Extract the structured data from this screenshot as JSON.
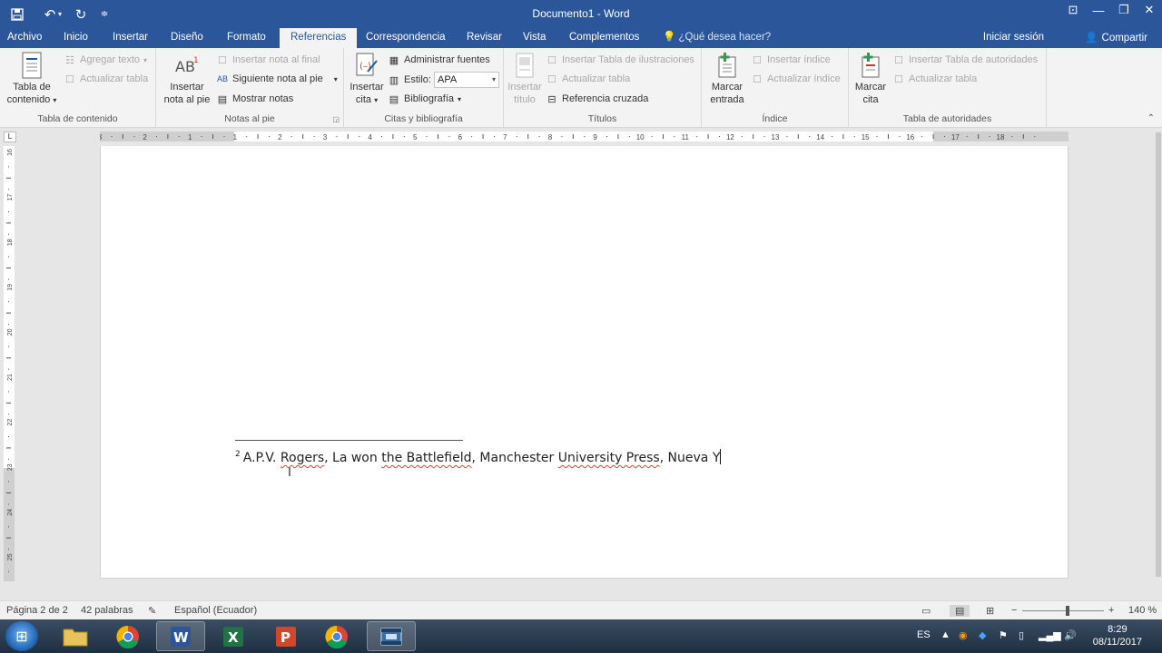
{
  "window": {
    "title": "Documento1 - Word"
  },
  "tabs": [
    {
      "label": "Archivo"
    },
    {
      "label": "Inicio"
    },
    {
      "label": "Insertar"
    },
    {
      "label": "Diseño"
    },
    {
      "label": "Formato"
    },
    {
      "label": "Referencias"
    },
    {
      "label": "Correspondencia"
    },
    {
      "label": "Revisar"
    },
    {
      "label": "Vista"
    },
    {
      "label": "Complementos"
    }
  ],
  "tell_me": "¿Qué desea hacer?",
  "sign_in": "Iniciar sesión",
  "share": "Compartir",
  "ribbon": {
    "toc": {
      "big_line1": "Tabla de",
      "big_line2": "contenido",
      "add_text": "Agregar texto",
      "update_table": "Actualizar tabla",
      "label": "Tabla de contenido"
    },
    "footnotes": {
      "big_line1": "Insertar",
      "big_line2": "nota al pie",
      "insert_endnote": "Insertar nota al final",
      "next_footnote": "Siguiente nota al pie",
      "show_notes": "Mostrar notas",
      "label": "Notas al pie"
    },
    "citations": {
      "big_line1": "Insertar",
      "big_line2": "cita",
      "manage_sources": "Administrar fuentes",
      "style_label": "Estilo:",
      "style_value": "APA",
      "bibliography": "Bibliografía",
      "label": "Citas y bibliografía"
    },
    "captions": {
      "big_line1": "Insertar",
      "big_line2": "título",
      "insert_table_figures": "Insertar Tabla de ilustraciones",
      "update_table": "Actualizar tabla",
      "cross_reference": "Referencia cruzada",
      "label": "Títulos"
    },
    "index": {
      "big_line1": "Marcar",
      "big_line2": "entrada",
      "insert_index": "Insertar índice",
      "update_index": "Actualizar índice",
      "label": "Índice"
    },
    "authorities": {
      "big_line1": "Marcar",
      "big_line2": "cita",
      "insert_table": "Insertar Tabla de autoridades",
      "update_table": "Actualizar tabla",
      "label": "Tabla de autoridades"
    }
  },
  "ruler": {
    "h_labels": [
      "3",
      "2",
      "1",
      "1",
      "2",
      "3",
      "4",
      "5",
      "6",
      "7",
      "8",
      "9",
      "10",
      "11",
      "12",
      "13",
      "14",
      "15",
      "16",
      "17",
      "18"
    ],
    "v_labels": [
      "16",
      "17",
      "18",
      "19",
      "20",
      "21",
      "22",
      "23",
      "24",
      "25"
    ]
  },
  "document": {
    "footnote_number": "2",
    "footnote_parts": [
      "A.P.V. ",
      "Rogers",
      ", La won ",
      "the Battlefield",
      ", Manchester ",
      "University Press",
      ", Nueva Y"
    ]
  },
  "status": {
    "page": "Página 2 de 2",
    "words": "42 palabras",
    "language": "Español (Ecuador)",
    "zoom_minus": "−",
    "zoom_plus": "+",
    "zoom": "140 %"
  },
  "taskbar": {
    "lang": "ES",
    "time": "8:29",
    "date": "08/11/2017"
  },
  "colors": {
    "word_blue": "#2b579a",
    "spell_error": "#d43"
  }
}
